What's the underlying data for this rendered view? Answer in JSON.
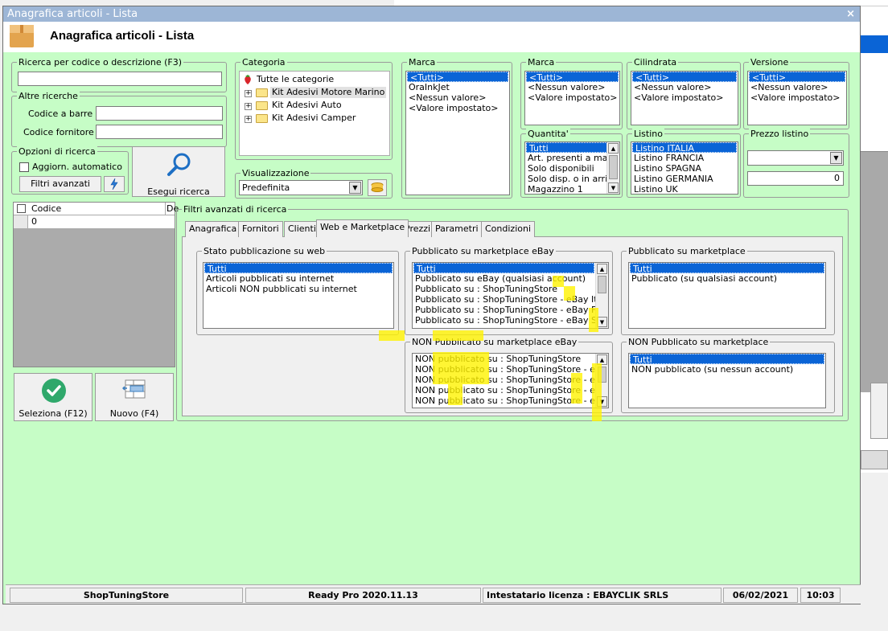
{
  "window": {
    "title": "Anagrafica articoli  - Lista",
    "header_title": "Anagrafica articoli  - Lista",
    "close": "×"
  },
  "search": {
    "group_label": "Ricerca per codice o descrizione (F3)",
    "value": "",
    "altre_label": "Altre ricerche",
    "barcode_label": "Codice a barre :",
    "supplier_code_label": "Codice fornitore :",
    "options_label": "Opzioni di ricerca",
    "auto_update_label": "Aggiorn. automatico",
    "advanced_filters_btn": "Filtri avanzati",
    "execute_btn": "Esegui ricerca"
  },
  "category": {
    "label": "Categoria",
    "root": "Tutte le categorie",
    "items": [
      "Kit Adesivi Motore Marino",
      "Kit Adesivi Auto",
      "Kit Adesivi Camper"
    ]
  },
  "view": {
    "label": "Visualizzazione",
    "value": "Predefinita"
  },
  "marca1": {
    "label": "Marca",
    "items": [
      "<Tutti>",
      "OraInkJet",
      "<Nessun valore>",
      "<Valore impostato>"
    ]
  },
  "marca2": {
    "label": "Marca",
    "items": [
      "<Tutti>",
      "<Nessun valore>",
      "<Valore impostato>"
    ]
  },
  "cilindrata": {
    "label": "Cilindrata",
    "items": [
      "<Tutti>",
      "<Nessun valore>",
      "<Valore impostato>"
    ]
  },
  "versione": {
    "label": "Versione",
    "items": [
      "<Tutti>",
      "<Nessun valore>",
      "<Valore impostato>"
    ]
  },
  "quantita": {
    "label": "Quantita'",
    "items": [
      "Tutti",
      "Art. presenti a maga",
      "Solo disponibili",
      "Solo disp. o in arrivo",
      "Magazzino 1"
    ]
  },
  "listino": {
    "label": "Listino",
    "items": [
      "Listino ITALIA",
      "Listino FRANCIA",
      "Listino SPAGNA",
      "Listino GERMANIA",
      "Listino UK"
    ]
  },
  "prezzo": {
    "label": "Prezzo listino",
    "combo": "",
    "value": "0"
  },
  "grid": {
    "col_code": "Codice",
    "col_desc": "De",
    "row_code": "0"
  },
  "buttons": {
    "select": "Seleziona (F12)",
    "new": "Nuovo (F4)"
  },
  "filters": {
    "label": "Filtri avanzati di ricerca",
    "tabs": [
      "Anagrafica",
      "Fornitori",
      "Clienti",
      "Web e Marketplace",
      "Prezzi",
      "Parametri",
      "Condizioni"
    ],
    "web_status": {
      "label": "Stato pubblicazione su web",
      "items": [
        "Tutti",
        "Articoli pubblicati su internet",
        "Articoli NON pubblicati su internet"
      ]
    },
    "ebay_pub": {
      "label": "Pubblicato su marketplace eBay",
      "items": [
        "Tutti",
        "Pubblicato su eBay (qualsiasi account)",
        "Pubblicato su : ShopTuningStore",
        "Pubblicato su : ShopTuningStore - eBay Italia",
        "Pubblicato su : ShopTuningStore - eBay Franci",
        "Pubblicato su : ShopTuningStore - eBay Spagn"
      ]
    },
    "mkt_pub": {
      "label": "Pubblicato su marketplace",
      "items": [
        "Tutti",
        "Pubblicato (su qualsiasi account)"
      ]
    },
    "ebay_nonpub": {
      "label": "NON Pubblicato su marketplace eBay",
      "items": [
        "NON pubblicato su : ShopTuningStore",
        "NON pubblicato su : ShopTuningStore - eBay I",
        "NON pubblicato su : ShopTuningStore - eBay Fi",
        "NON pubblicato su : ShopTuningStore - eBay S",
        "NON pubblicato su : ShopTuningStore - eBay G"
      ]
    },
    "mkt_nonpub": {
      "label": "NON Pubblicato su marketplace",
      "items": [
        "Tutti",
        "NON pubblicato (su nessun account)"
      ]
    }
  },
  "status": {
    "store": "ShopTuningStore",
    "version": "Ready Pro 2020.11.13",
    "license": "Intestatario licenza : EBAYCLIK SRLS",
    "date": "06/02/2021",
    "time": "10:03"
  },
  "colors": {
    "accent": "#0a64d6",
    "background": "#c6fdc6",
    "highlight": "#fff200"
  }
}
